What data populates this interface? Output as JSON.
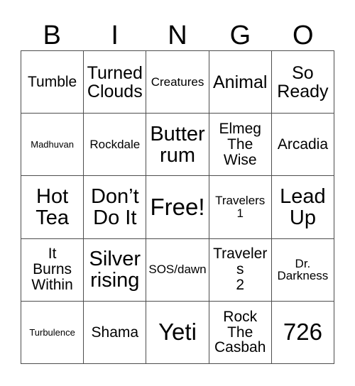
{
  "card": {
    "title_letters": [
      "B",
      "I",
      "N",
      "G",
      "O"
    ],
    "rows": [
      [
        {
          "text": "Tumble",
          "size": "m"
        },
        {
          "text": "Turned\nClouds",
          "size": "l"
        },
        {
          "text": "Creatures",
          "size": "s"
        },
        {
          "text": "Animal",
          "size": "l"
        },
        {
          "text": "So\nReady",
          "size": "l"
        }
      ],
      [
        {
          "text": "Madhuvan",
          "size": "xs"
        },
        {
          "text": "Rockdale",
          "size": "s"
        },
        {
          "text": "Butter\nrum",
          "size": "xl"
        },
        {
          "text": "Elmeg\nThe\nWise",
          "size": "m"
        },
        {
          "text": "Arcadia",
          "size": "m"
        }
      ],
      [
        {
          "text": "Hot\nTea",
          "size": "xl"
        },
        {
          "text": "Don’t\nDo It",
          "size": "xl"
        },
        {
          "text": "Free!",
          "size": "xxl"
        },
        {
          "text": "Travelers\n1",
          "size": "s"
        },
        {
          "text": "Lead\nUp",
          "size": "xl"
        }
      ],
      [
        {
          "text": "It\nBurns\nWithin",
          "size": "m"
        },
        {
          "text": "Silver\nrising",
          "size": "xl"
        },
        {
          "text": "SOS/dawn",
          "size": "s"
        },
        {
          "text": "Travelers\n2",
          "size": "m"
        },
        {
          "text": "Dr.\nDarkness",
          "size": "s"
        }
      ],
      [
        {
          "text": "Turbulence",
          "size": "xs"
        },
        {
          "text": "Shama",
          "size": "m"
        },
        {
          "text": "Yeti",
          "size": "xxl"
        },
        {
          "text": "Rock\nThe\nCasbah",
          "size": "m"
        },
        {
          "text": "726",
          "size": "xxl"
        }
      ]
    ],
    "free_space": "Free!",
    "grid_size": "5x5",
    "border_color": "#4d4d4d",
    "text_color": "#000000",
    "background_color": "#ffffff"
  }
}
